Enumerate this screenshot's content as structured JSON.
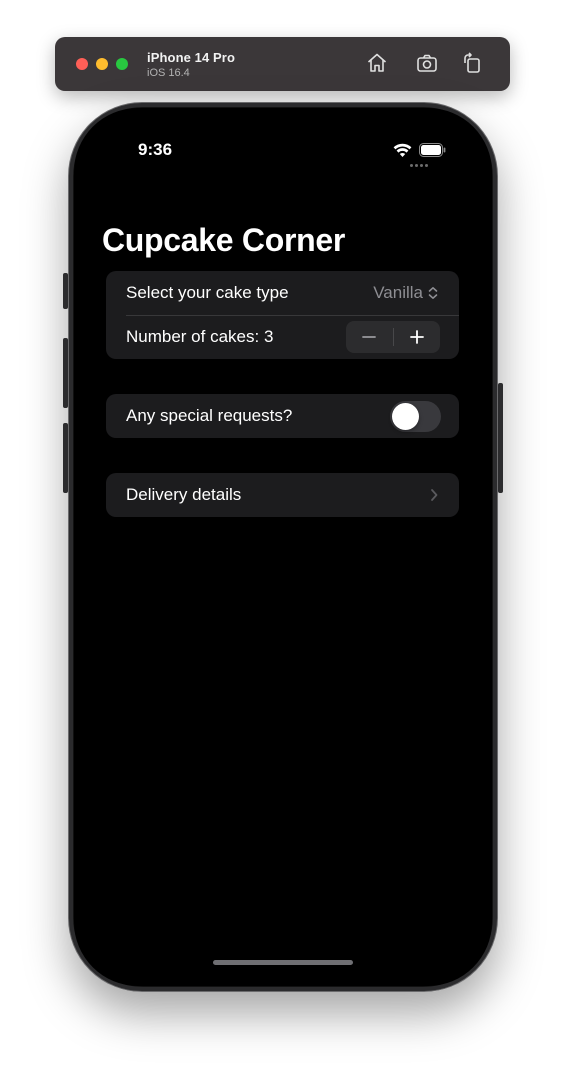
{
  "simulator": {
    "device_name": "iPhone 14 Pro",
    "os_version": "iOS 16.4",
    "icons": [
      "home-icon",
      "screenshot-icon",
      "rotate-icon"
    ]
  },
  "status_bar": {
    "time": "9:36",
    "icons": [
      "signal-dots-icon",
      "wifi-icon",
      "battery-icon"
    ]
  },
  "nav": {
    "title": "Cupcake Corner"
  },
  "form": {
    "cake_type": {
      "label": "Select your cake type",
      "value": "Vanilla"
    },
    "quantity": {
      "label": "Number of cakes: 3",
      "minus": "−",
      "plus": "+"
    },
    "special_requests": {
      "label": "Any special requests?",
      "enabled": false
    },
    "delivery": {
      "label": "Delivery details"
    }
  },
  "colors": {
    "background": "#000000",
    "cell": "#1c1c1e",
    "secondary_text": "#8e8e93",
    "toggle_off": "#39393d"
  }
}
